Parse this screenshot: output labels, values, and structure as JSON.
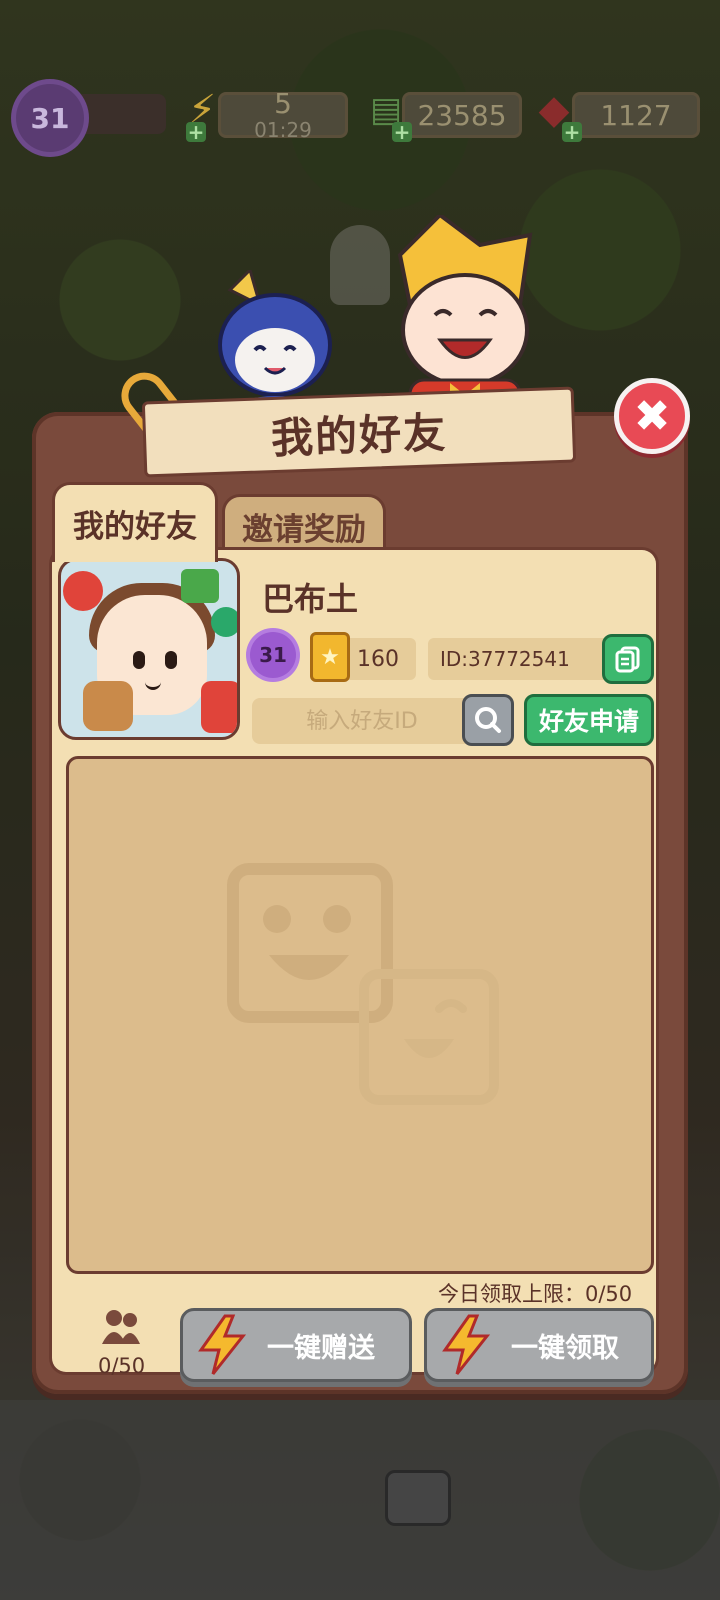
{
  "hud": {
    "level": "31",
    "energy": "5",
    "energy_timer": "01:29",
    "cash": "23585",
    "gems": "1127"
  },
  "dialog": {
    "title": "我的好友",
    "tabs": [
      {
        "label": "我的好友",
        "active": true
      },
      {
        "label": "邀请奖励",
        "active": false
      }
    ],
    "profile": {
      "name": "巴布土",
      "level": "31",
      "score": "160",
      "id": "ID:37772541"
    },
    "search": {
      "placeholder": "输入好友ID",
      "request_label": "好友申请"
    },
    "daily_limit": "今日领取上限：0/50",
    "friend_count": "0/50",
    "actions": {
      "send_all": "一键赠送",
      "claim_all": "一键领取"
    }
  },
  "colors": {
    "panel": "#7a4a3c",
    "panel_inner": "#f3dfb3",
    "green_button": "#3cb86e",
    "close_button": "#e84a55",
    "gray_button": "#a7a9ab"
  }
}
